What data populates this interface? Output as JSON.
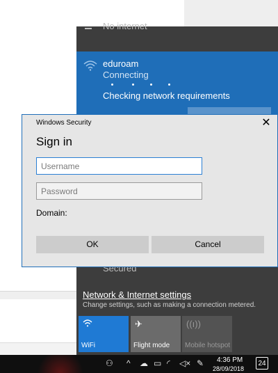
{
  "flyout": {
    "no_internet": "No internet",
    "network": {
      "name": "eduroam",
      "status": "Connecting",
      "requirements": "Checking network requirements"
    },
    "secured": "Secured",
    "settings_link": "Network & Internet settings",
    "settings_desc": "Change settings, such as making a connection metered.",
    "tiles": [
      {
        "label": "WiFi",
        "icon": "wifi-icon",
        "active": true
      },
      {
        "label": "Flight mode",
        "icon": "airplane-icon",
        "active": false
      },
      {
        "label": "Mobile hotspot",
        "icon": "hotspot-icon",
        "active": false
      }
    ]
  },
  "dialog": {
    "title": "Windows Security",
    "heading": "Sign in",
    "username_placeholder": "Username",
    "password_placeholder": "Password",
    "domain_label": "Domain:",
    "ok_label": "OK",
    "cancel_label": "Cancel"
  },
  "taskbar": {
    "time": "4:36 PM",
    "date": "28/09/2018",
    "notification_count": "24"
  },
  "colors": {
    "accent": "#1f6eb8",
    "tile_active": "#1f7ad4",
    "flyout_bg": "#3d3d3d",
    "dialog_bg": "#e6e6e6"
  }
}
